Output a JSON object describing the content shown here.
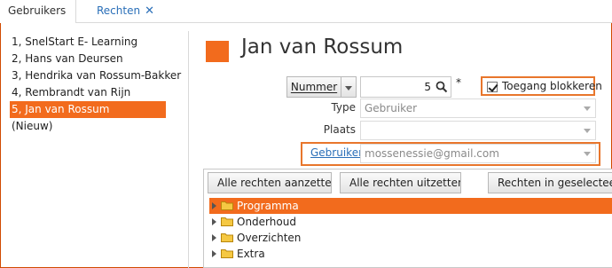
{
  "tabs": [
    {
      "label": "Gebruikers"
    },
    {
      "label": "Rechten",
      "close": "✕"
    }
  ],
  "users": [
    {
      "label": "1, SnelStart E- Learning"
    },
    {
      "label": "2, Hans van Deursen"
    },
    {
      "label": "3, Hendrika van Rossum-Bakker"
    },
    {
      "label": "4, Rembrandt van Rijn"
    },
    {
      "label": "5, Jan van Rossum",
      "selected": true
    },
    {
      "label": "(Nieuw)"
    }
  ],
  "header": {
    "title": "Jan van Rossum"
  },
  "form": {
    "nummer_button": "Nummer",
    "nummer_value": "5",
    "required_marker": "*",
    "toegang_label": "Toegang blokkeren",
    "toegang_checked": true,
    "type_label": "Type",
    "type_value": "Gebruiker",
    "plaats_label": "Plaats",
    "plaats_value": "",
    "gebruiker_label": "Gebruiker",
    "gebruiker_value": "mossenessie@gmail.com"
  },
  "rights": {
    "buttons": [
      "Alle rechten aanzetten",
      "Alle rechten uitzetten",
      "Rechten in geselecteerd"
    ],
    "tree": [
      {
        "label": "Programma",
        "selected": true
      },
      {
        "label": "Onderhoud"
      },
      {
        "label": "Overzichten"
      },
      {
        "label": "Extra"
      }
    ]
  },
  "colors": {
    "accent": "#f26b1d",
    "highlight_border": "#e8762c",
    "link": "#2a6fb8"
  }
}
